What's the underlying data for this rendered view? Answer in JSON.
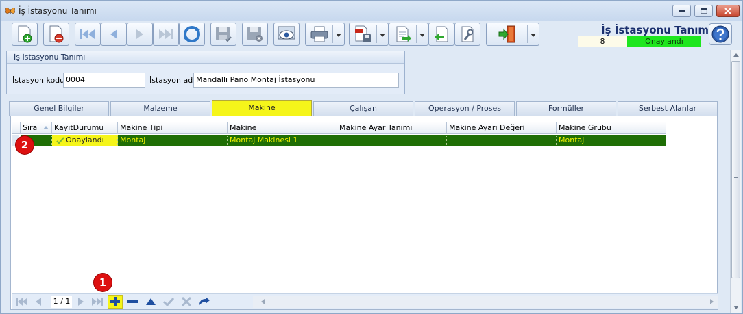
{
  "window": {
    "title": "İş İstasyonu Tanımı"
  },
  "header": {
    "title": "İş İstasyonu Tanımı",
    "record_number": "8",
    "record_status": "Onaylandı"
  },
  "group": {
    "title": "İş İstasyonu Tanımı",
    "station_code_label": "İstasyon kodu",
    "station_code_value": "0004",
    "station_name_label": "İstasyon adı",
    "station_name_value": "Mandallı Pano Montaj İstasyonu"
  },
  "tabs": [
    {
      "label": "Genel Bilgiler"
    },
    {
      "label": "Malzeme"
    },
    {
      "label": "Makine"
    },
    {
      "label": "Çalışan"
    },
    {
      "label": "Operasyon / Proses"
    },
    {
      "label": "Formüller"
    },
    {
      "label": "Serbest Alanlar"
    }
  ],
  "active_tab": "Makine",
  "grid": {
    "columns": [
      "Sıra",
      "KayıtDurumu",
      "Makine Tipi",
      "Makine",
      "Makine Ayar Tanımı",
      "Makine Ayarı Değeri",
      "Makine Grubu"
    ],
    "rows": [
      {
        "sira": "",
        "kayit_durumu": "Onaylandı",
        "makine_tipi": "Montaj",
        "makine": "Montaj Makinesi 1",
        "ayar_tanimi": "",
        "ayar_degeri": "",
        "makine_grubu": "Montaj"
      }
    ]
  },
  "navigator": {
    "page_indicator": "1 / 1"
  },
  "badges": {
    "one": "1",
    "two": "2"
  },
  "colors": {
    "approved_green": "#1ee61e",
    "highlight_yellow": "#f5f51a",
    "row_dark_green": "#1f6e05",
    "badge_red": "#dd1010"
  }
}
